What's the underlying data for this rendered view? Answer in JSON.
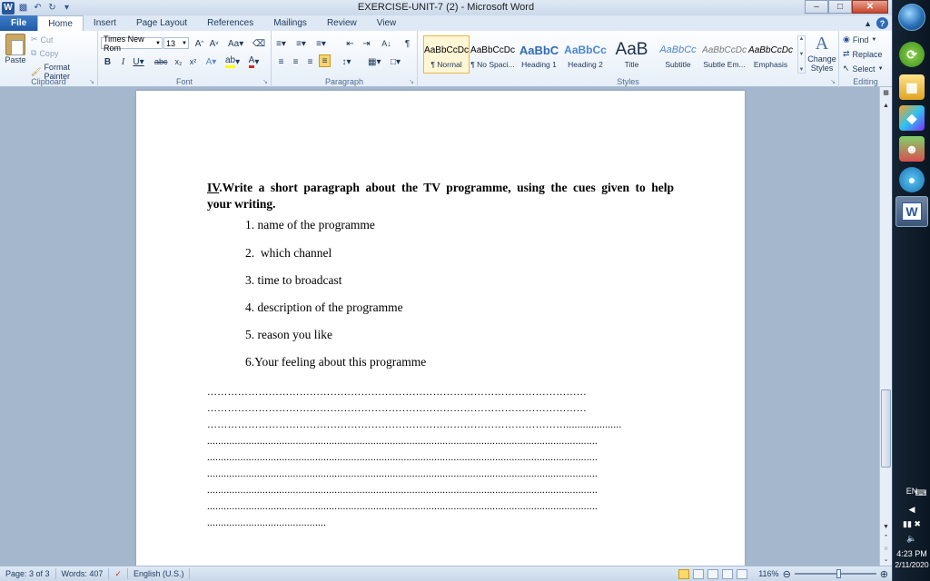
{
  "app": {
    "title": "EXERCISE-UNIT-7 (2)  -  Microsoft Word",
    "colors": {
      "accent": "#2b579a",
      "file_tab": "#1e5aa8",
      "ribbon_text": "#1e395b"
    }
  },
  "tabs": [
    {
      "label": "File"
    },
    {
      "label": "Home"
    },
    {
      "label": "Insert"
    },
    {
      "label": "Page Layout"
    },
    {
      "label": "References"
    },
    {
      "label": "Mailings"
    },
    {
      "label": "Review"
    },
    {
      "label": "View"
    }
  ],
  "ribbon": {
    "clipboard": {
      "paste": "Paste",
      "cut": "Cut",
      "copy": "Copy",
      "format_painter": "Format Painter",
      "label": "Clipboard"
    },
    "font": {
      "family": "Times New Rom",
      "size": "13",
      "label": "Font"
    },
    "paragraph": {
      "label": "Paragraph"
    },
    "styles": {
      "label": "Styles",
      "items": [
        {
          "preview": "AaBbCcDc",
          "name": "¶ Normal"
        },
        {
          "preview": "AaBbCcDc",
          "name": "¶ No Spaci..."
        },
        {
          "preview": "AaBbC",
          "name": "Heading 1"
        },
        {
          "preview": "AaBbCc",
          "name": "Heading 2"
        },
        {
          "preview": "AaB",
          "name": "Title"
        },
        {
          "preview": "AaBbCc",
          "name": "Subtitle"
        },
        {
          "preview": "AaBbCcDc",
          "name": "Subtle Em..."
        },
        {
          "preview": "AaBbCcDc",
          "name": "Emphasis"
        }
      ],
      "change_styles": "Change Styles"
    },
    "editing": {
      "find": "Find",
      "replace": "Replace",
      "select": "Select",
      "label": "Editing"
    }
  },
  "document": {
    "heading_prefix": "IV",
    "heading_line1": ".Write a short paragraph about the TV programme, using the cues given to help",
    "heading_line2": "your writing.",
    "cues": [
      "1. name of the programme",
      "2.  which channel",
      "3. time to broadcast",
      "4. description of the programme",
      "5. reason you like",
      "6.Your feeling about this programme"
    ],
    "dot_lines": [
      "…………………………………………………………………………………………………",
      "…………………………………………………………………………………………………",
      "……………………………………………………………………………………………....................",
      ".............................................................................................................................................",
      ".............................................................................................................................................",
      ".............................................................................................................................................",
      ".............................................................................................................................................",
      ".............................................................................................................................................",
      "..........................................."
    ]
  },
  "status": {
    "page": "Page: 3 of 3",
    "words": "Words: 407",
    "language": "English (U.S.)",
    "zoom": "116%"
  },
  "taskbar": {
    "lang": "EN",
    "time": "4:23 PM",
    "date": "2/11/2020"
  }
}
